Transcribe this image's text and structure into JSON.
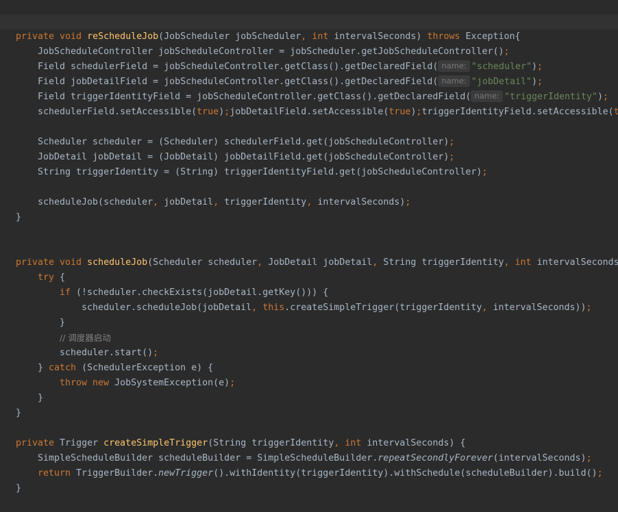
{
  "editor": {
    "lines": [
      {
        "indent": 0,
        "current": true,
        "tokens": []
      },
      {
        "indent": 0,
        "tokens": [
          {
            "t": "private void ",
            "c": "kw"
          },
          {
            "t": "reScheduleJob",
            "c": "fn"
          },
          {
            "t": "(JobScheduler jobScheduler"
          },
          {
            "t": ", ",
            "c": "kw"
          },
          {
            "t": "int ",
            "c": "kw"
          },
          {
            "t": "intervalSeconds) "
          },
          {
            "t": "throws ",
            "c": "kw"
          },
          {
            "t": "Exception{"
          }
        ]
      },
      {
        "indent": 1,
        "tokens": [
          {
            "t": "JobScheduleController jobScheduleController = jobScheduler.getJobScheduleController()"
          },
          {
            "t": ";",
            "c": "kw"
          }
        ]
      },
      {
        "indent": 1,
        "tokens": [
          {
            "t": "Field schedulerField = jobScheduleController.getClass().getDeclaredField("
          },
          {
            "t": "name:",
            "c": "hint"
          },
          {
            "t": "\"scheduler\"",
            "c": "str"
          },
          {
            "t": ")"
          },
          {
            "t": ";",
            "c": "kw"
          }
        ]
      },
      {
        "indent": 1,
        "tokens": [
          {
            "t": "Field jobDetailField = jobScheduleController.getClass().getDeclaredField("
          },
          {
            "t": "name:",
            "c": "hint"
          },
          {
            "t": "\"jobDetail\"",
            "c": "str"
          },
          {
            "t": ")"
          },
          {
            "t": ";",
            "c": "kw"
          }
        ]
      },
      {
        "indent": 1,
        "tokens": [
          {
            "t": "Field triggerIdentityField = jobScheduleController.getClass().getDeclaredField("
          },
          {
            "t": "name:",
            "c": "hint"
          },
          {
            "t": "\"triggerIdentity\"",
            "c": "str"
          },
          {
            "t": ")"
          },
          {
            "t": ";",
            "c": "kw"
          }
        ]
      },
      {
        "indent": 1,
        "tokens": [
          {
            "t": "schedulerField.setAccessible("
          },
          {
            "t": "true",
            "c": "kw"
          },
          {
            "t": ")"
          },
          {
            "t": ";",
            "c": "kw"
          },
          {
            "t": "jobDetailField.setAccessible("
          },
          {
            "t": "true",
            "c": "kw"
          },
          {
            "t": ")"
          },
          {
            "t": ";",
            "c": "kw"
          },
          {
            "t": "triggerIdentityField.setAccessible("
          },
          {
            "t": "t",
            "c": "kw"
          }
        ]
      },
      {
        "indent": 0,
        "tokens": []
      },
      {
        "indent": 1,
        "tokens": [
          {
            "t": "Scheduler scheduler = (Scheduler) schedulerField.get(jobScheduleController)"
          },
          {
            "t": ";",
            "c": "kw"
          }
        ]
      },
      {
        "indent": 1,
        "tokens": [
          {
            "t": "JobDetail jobDetail = (JobDetail) jobDetailField.get(jobScheduleController)"
          },
          {
            "t": ";",
            "c": "kw"
          }
        ]
      },
      {
        "indent": 1,
        "tokens": [
          {
            "t": "String triggerIdentity = (String) triggerIdentityField.get(jobScheduleController)"
          },
          {
            "t": ";",
            "c": "kw"
          }
        ]
      },
      {
        "indent": 0,
        "tokens": []
      },
      {
        "indent": 1,
        "tokens": [
          {
            "t": "scheduleJob(scheduler"
          },
          {
            "t": ", ",
            "c": "kw"
          },
          {
            "t": "jobDetail"
          },
          {
            "t": ", ",
            "c": "kw"
          },
          {
            "t": "triggerIdentity"
          },
          {
            "t": ", ",
            "c": "kw"
          },
          {
            "t": "intervalSeconds)"
          },
          {
            "t": ";",
            "c": "kw"
          }
        ]
      },
      {
        "indent": 0,
        "tokens": [
          {
            "t": "}"
          }
        ]
      },
      {
        "indent": 0,
        "tokens": []
      },
      {
        "indent": 0,
        "tokens": []
      },
      {
        "indent": 0,
        "tokens": [
          {
            "t": "private void ",
            "c": "kw"
          },
          {
            "t": "scheduleJob",
            "c": "fn"
          },
          {
            "t": "(Scheduler scheduler"
          },
          {
            "t": ", ",
            "c": "kw"
          },
          {
            "t": "JobDetail jobDetail"
          },
          {
            "t": ", ",
            "c": "kw"
          },
          {
            "t": "String triggerIdentity"
          },
          {
            "t": ", ",
            "c": "kw"
          },
          {
            "t": "int ",
            "c": "kw"
          },
          {
            "t": "intervalSeconds"
          }
        ]
      },
      {
        "indent": 1,
        "tokens": [
          {
            "t": "try ",
            "c": "kw"
          },
          {
            "t": "{"
          }
        ]
      },
      {
        "indent": 2,
        "tokens": [
          {
            "t": "if ",
            "c": "kw"
          },
          {
            "t": "(!scheduler.checkExists(jobDetail.getKey())) {"
          }
        ]
      },
      {
        "indent": 3,
        "tokens": [
          {
            "t": "scheduler.scheduleJob(jobDetail"
          },
          {
            "t": ", ",
            "c": "kw"
          },
          {
            "t": "this",
            "c": "kw"
          },
          {
            "t": ".createSimpleTrigger(triggerIdentity"
          },
          {
            "t": ", ",
            "c": "kw"
          },
          {
            "t": "intervalSeconds))"
          },
          {
            "t": ";",
            "c": "kw"
          }
        ]
      },
      {
        "indent": 2,
        "tokens": [
          {
            "t": "}"
          }
        ]
      },
      {
        "indent": 2,
        "tokens": [
          {
            "t": "// 调度器启动",
            "c": "cm"
          }
        ]
      },
      {
        "indent": 2,
        "tokens": [
          {
            "t": "scheduler.start()"
          },
          {
            "t": ";",
            "c": "kw"
          }
        ]
      },
      {
        "indent": 1,
        "tokens": [
          {
            "t": "} "
          },
          {
            "t": "catch ",
            "c": "kw"
          },
          {
            "t": "(SchedulerException e) {"
          }
        ]
      },
      {
        "indent": 2,
        "tokens": [
          {
            "t": "throw new ",
            "c": "kw"
          },
          {
            "t": "JobSystemException(e)"
          },
          {
            "t": ";",
            "c": "kw"
          }
        ]
      },
      {
        "indent": 1,
        "tokens": [
          {
            "t": "}"
          }
        ]
      },
      {
        "indent": 0,
        "tokens": [
          {
            "t": "}"
          }
        ]
      },
      {
        "indent": 0,
        "tokens": []
      },
      {
        "indent": 0,
        "tokens": [
          {
            "t": "private ",
            "c": "kw"
          },
          {
            "t": "Trigger "
          },
          {
            "t": "createSimpleTrigger",
            "c": "fn"
          },
          {
            "t": "(String triggerIdentity"
          },
          {
            "t": ", ",
            "c": "kw"
          },
          {
            "t": "int ",
            "c": "kw"
          },
          {
            "t": "intervalSeconds) {"
          }
        ]
      },
      {
        "indent": 1,
        "tokens": [
          {
            "t": "SimpleScheduleBuilder scheduleBuilder = SimpleScheduleBuilder."
          },
          {
            "t": "repeatSecondlyForever",
            "c": "it"
          },
          {
            "t": "(intervalSeconds)"
          },
          {
            "t": ";",
            "c": "kw"
          }
        ]
      },
      {
        "indent": 1,
        "tokens": [
          {
            "t": "return ",
            "c": "kw"
          },
          {
            "t": "TriggerBuilder."
          },
          {
            "t": "newTrigger",
            "c": "it"
          },
          {
            "t": "().withIdentity(triggerIdentity).withSchedule(scheduleBuilder).build()"
          },
          {
            "t": ";",
            "c": "kw"
          }
        ]
      },
      {
        "indent": 0,
        "tokens": [
          {
            "t": "}"
          }
        ]
      }
    ]
  }
}
